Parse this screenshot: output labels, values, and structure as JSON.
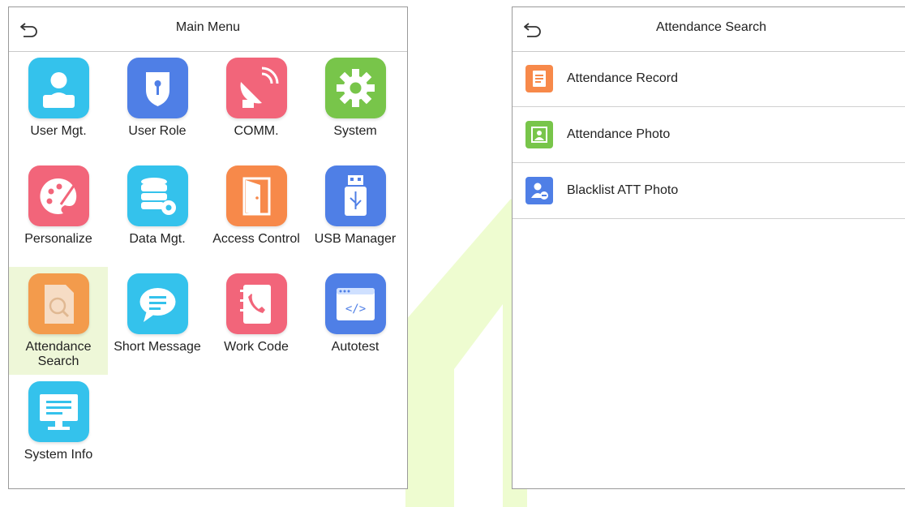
{
  "main_menu": {
    "title": "Main Menu",
    "tiles": [
      {
        "label": "User Mgt.",
        "icon": "user-icon",
        "color": "#34c2ec"
      },
      {
        "label": "User Role",
        "icon": "shield-key-icon",
        "color": "#4f7fe6"
      },
      {
        "label": "COMM.",
        "icon": "satellite-dish-icon",
        "color": "#f2657a"
      },
      {
        "label": "System",
        "icon": "gear-icon",
        "color": "#78c54a"
      },
      {
        "label": "Personalize",
        "icon": "palette-icon",
        "color": "#f2657a"
      },
      {
        "label": "Data Mgt.",
        "icon": "database-icon",
        "color": "#34c2ec"
      },
      {
        "label": "Access Control",
        "icon": "door-icon",
        "color": "#f7894a"
      },
      {
        "label": "USB Manager",
        "icon": "usb-icon",
        "color": "#4f7fe6"
      },
      {
        "label": "Attendance Search",
        "label_line1": "Attendance",
        "label_line2": "Search",
        "icon": "search-document-icon",
        "color": "#f39b4c",
        "selected": true
      },
      {
        "label": "Short Message",
        "icon": "chat-bubble-icon",
        "color": "#34c2ec"
      },
      {
        "label": "Work Code",
        "icon": "notebook-phone-icon",
        "color": "#f2657a"
      },
      {
        "label": "Autotest",
        "icon": "code-window-icon",
        "color": "#4f7fe6"
      },
      {
        "label": "System Info",
        "icon": "monitor-icon",
        "color": "#34c2ec"
      }
    ]
  },
  "attendance_search": {
    "title": "Attendance Search",
    "items": [
      {
        "label": "Attendance Record",
        "icon": "record-list-icon",
        "color": "#f7894a"
      },
      {
        "label": "Attendance Photo",
        "icon": "photo-portrait-icon",
        "color": "#78c54a"
      },
      {
        "label": "Blacklist ATT Photo",
        "icon": "user-blocked-icon",
        "color": "#4f7fe6"
      }
    ]
  },
  "colors": {
    "selected_bg": "#eef7d8",
    "watermark": "#ecfcc6"
  }
}
